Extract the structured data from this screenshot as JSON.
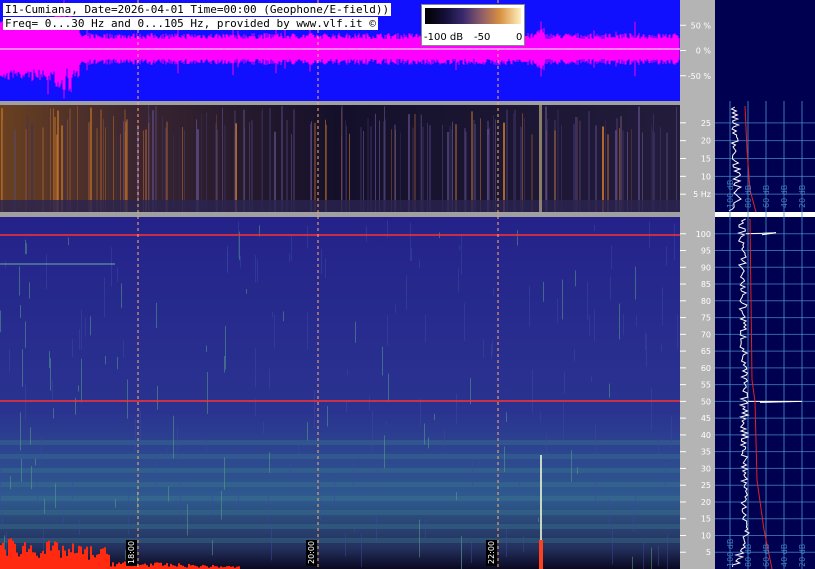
{
  "header": {
    "title_line1": "I1-Cumiana, Date=2026-04-01 Time=00:00 (Geophone/E-field))",
    "title_line2": "Freq= 0...30 Hz and 0...105 Hz, provided by www.vlf.it ©"
  },
  "colorbar": {
    "labels": [
      "-100 dB",
      "-50",
      "0"
    ]
  },
  "time_labels": [
    "18:00",
    "20:00",
    "22:00"
  ],
  "colors": {
    "waveform_bg": "#1010ff",
    "waveform": "#ff00ff",
    "spectro_low_bg": "#1e1e82",
    "spectro_top_bg": "#140f2a",
    "side_panel_bg": "#000050",
    "axis_bg": "#b4b4b4",
    "line_50hz": "#ff2020",
    "grid_side": "#4a90d0"
  },
  "chart_data": [
    {
      "type": "line",
      "name_role": "waveform amplitude",
      "ytick_labels": [
        "50 %",
        "0 %",
        "-50 %"
      ],
      "ytick_values": [
        50,
        0,
        -50
      ],
      "ylim": [
        -100,
        100
      ]
    },
    {
      "type": "heatmap",
      "name_role": "geophone spectrogram 0-30 Hz",
      "ytick_labels": [
        "25",
        "20",
        "15",
        "10",
        "5 Hz"
      ],
      "ytick_values": [
        25,
        20,
        15,
        10,
        5
      ],
      "ylim": [
        0,
        30
      ]
    },
    {
      "type": "heatmap",
      "name_role": "E-field spectrogram 0-105 Hz",
      "ytick_labels": [
        "100",
        "95",
        "90",
        "85",
        "80",
        "75",
        "70",
        "65",
        "60",
        "55",
        "50",
        "45",
        "40",
        "35",
        "30",
        "25",
        "20",
        "15",
        "10",
        "5"
      ],
      "ytick_values": [
        100,
        95,
        90,
        85,
        80,
        75,
        70,
        65,
        60,
        55,
        50,
        45,
        40,
        35,
        30,
        25,
        20,
        15,
        10,
        5
      ],
      "ylim": [
        0,
        105
      ],
      "line_frequencies_hz": [
        100,
        50
      ]
    },
    {
      "type": "line",
      "name_role": "spectrum level scale",
      "xtick_labels": [
        "100 dB",
        "80 dB",
        "60 dB",
        "40 dB",
        "20 dB"
      ]
    }
  ]
}
